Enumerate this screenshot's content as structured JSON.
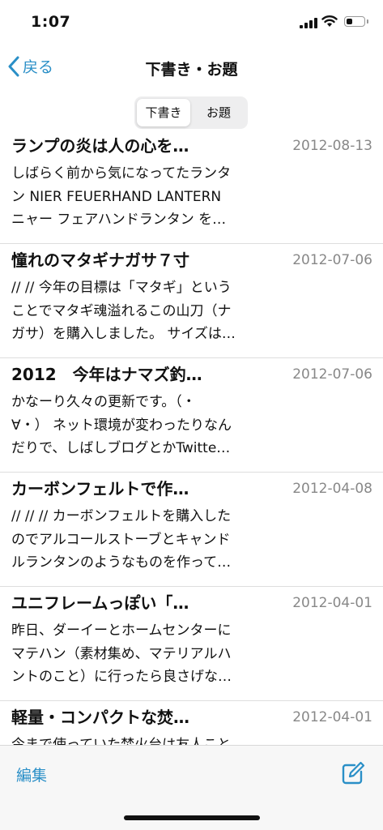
{
  "status": {
    "time": "1:07"
  },
  "nav": {
    "back_label": "戻る",
    "title": "下書き・お題"
  },
  "segments": {
    "drafts": "下書き",
    "topics": "お題",
    "selected": "drafts"
  },
  "items": [
    {
      "title": "ランプの炎は人の心を…",
      "date": "2012-08-13",
      "lines": [
        "しばらく前から気になってたランタ",
        "ン NIER FEUERHAND LANTERN",
        "ニャー フェアハンドランタン を…"
      ]
    },
    {
      "title": "憧れのマタギナガサ７寸",
      "date": "2012-07-06",
      "lines": [
        "// // 今年の目標は「マタギ」という",
        "ことでマタギ魂溢れるこの山刀（ナ",
        "ガサ）を購入しました。 サイズは…"
      ]
    },
    {
      "title": "2012　今年はナマズ釣…",
      "date": "2012-07-06",
      "lines": [
        "かなーり久々の更新です。（・",
        "∀・） ネット環境が変わったりなん",
        "だりで、しばしブログとかTwitte…"
      ]
    },
    {
      "title": "カーボンフェルトで作…",
      "date": "2012-04-08",
      "lines": [
        "// // // カーボンフェルトを購入した",
        "のでアルコールストーブとキャンド",
        "ルランタンのようなものを作って…"
      ]
    },
    {
      "title": "ユニフレームっぽい「…",
      "date": "2012-04-01",
      "lines": [
        "昨日、ダーイーとホームセンターに",
        "マテハン（素材集め、マテリアルハ",
        "ントのこと）に行ったら良さげな…"
      ]
    },
    {
      "title": "軽量・コンパクトな焚…",
      "date": "2012-04-01",
      "lines": [
        "今まで使っていた焚火台は友人こと",
        "",
        ""
      ]
    }
  ],
  "toolbar": {
    "edit_label": "編集"
  },
  "colors": {
    "accent": "#2a8fc7",
    "date_gray": "#888888"
  }
}
